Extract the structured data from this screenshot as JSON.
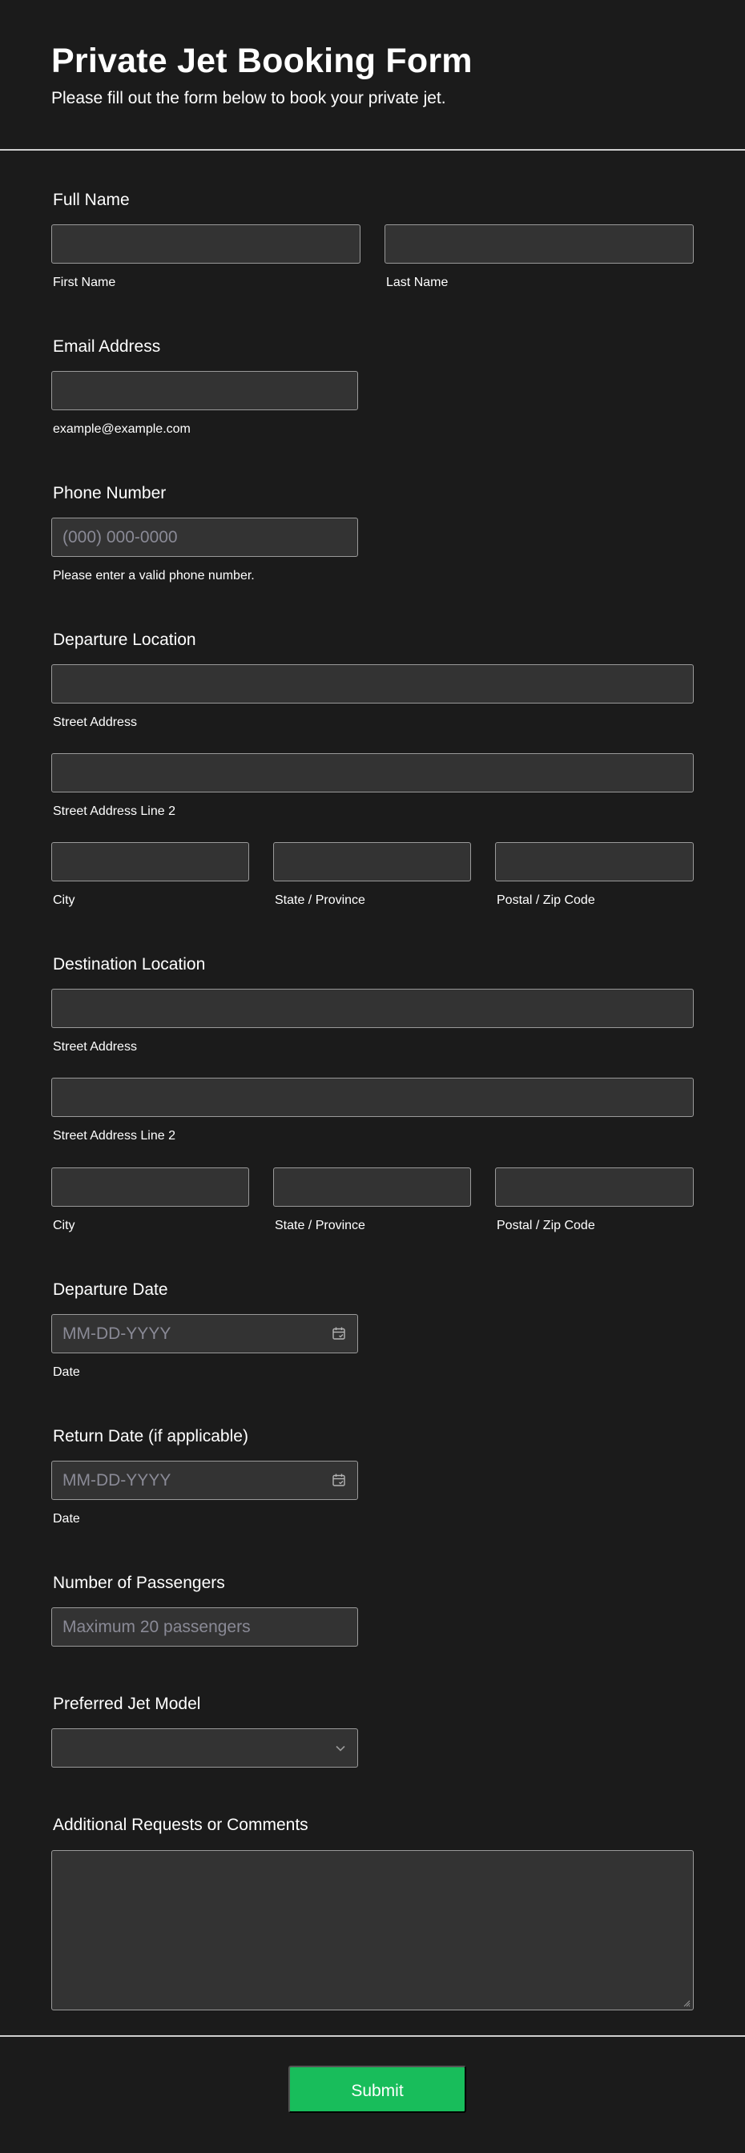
{
  "header": {
    "title": "Private Jet Booking Form",
    "subtitle": "Please fill out the form below to book your private jet."
  },
  "full_name": {
    "label": "Full Name",
    "first_label": "First Name",
    "last_label": "Last Name",
    "first_value": "",
    "last_value": ""
  },
  "email": {
    "label": "Email Address",
    "value": "",
    "hint": "example@example.com"
  },
  "phone": {
    "label": "Phone Number",
    "placeholder": "(000) 000-0000",
    "hint": "Please enter a valid phone number."
  },
  "departure": {
    "label": "Departure Location",
    "street": "Street Address",
    "street2": "Street Address Line 2",
    "city": "City",
    "state": "State / Province",
    "zip": "Postal / Zip Code"
  },
  "destination": {
    "label": "Destination Location",
    "street": "Street Address",
    "street2": "Street Address Line 2",
    "city": "City",
    "state": "State / Province",
    "zip": "Postal / Zip Code"
  },
  "departure_date": {
    "label": "Departure Date",
    "placeholder": "MM-DD-YYYY",
    "hint": "Date",
    "icon": "calendar-icon"
  },
  "return_date": {
    "label": "Return Date (if applicable)",
    "placeholder": "MM-DD-YYYY",
    "hint": "Date",
    "icon": "calendar-icon"
  },
  "passengers": {
    "label": "Number of Passengers",
    "placeholder": "Maximum 20 passengers"
  },
  "jet_model": {
    "label": "Preferred Jet Model",
    "selected": "",
    "icon": "chevron-down-icon"
  },
  "comments": {
    "label": "Additional Requests or Comments",
    "value": ""
  },
  "submit": {
    "label": "Submit",
    "color": "#18bd5b"
  },
  "colors": {
    "background": "#1b1b1b",
    "field": "#333333",
    "border": "#9a9a9a",
    "placeholder": "#8a8a96"
  }
}
